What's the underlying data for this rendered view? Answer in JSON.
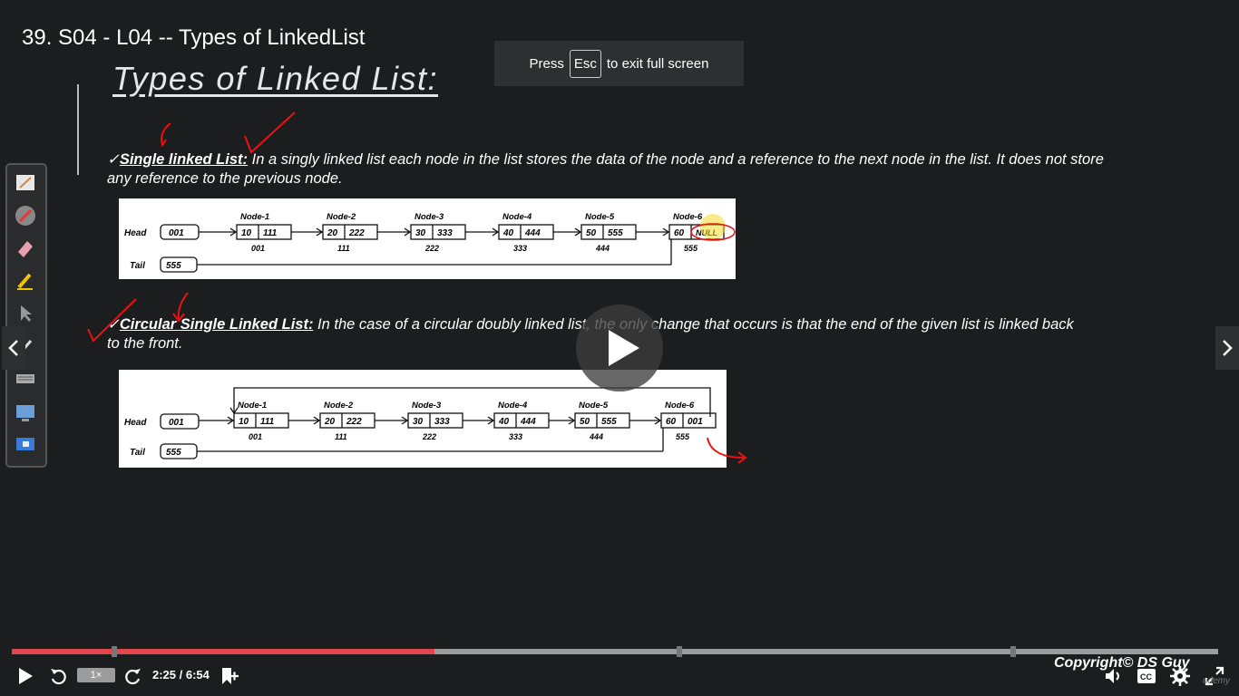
{
  "header": {
    "lecture_title": "39. S04 - L04 -- Types of LinkedList"
  },
  "fullscreen_notice": {
    "press": "Press",
    "key": "Esc",
    "suffix": "to exit full screen"
  },
  "slide": {
    "heading": "Types of Linked List:",
    "single": {
      "label": "Single linked List:",
      "text": "In a singly linked list each node in the list stores the data of the node and a reference to the next node in the list. It does not store any reference to the previous node."
    },
    "circular": {
      "label": "Circular Single Linked List:",
      "text": "In the case of a circular doubly linked list, the only change that occurs is that the end of the given list is linked back to the front."
    },
    "diagram_single": {
      "head_label": "Head",
      "head_value": "001",
      "tail_label": "Tail",
      "tail_value": "555",
      "nodes": [
        {
          "name": "Node-1",
          "data": "10",
          "next": "111",
          "addr": "001"
        },
        {
          "name": "Node-2",
          "data": "20",
          "next": "222",
          "addr": "111"
        },
        {
          "name": "Node-3",
          "data": "30",
          "next": "333",
          "addr": "222"
        },
        {
          "name": "Node-4",
          "data": "40",
          "next": "444",
          "addr": "333"
        },
        {
          "name": "Node-5",
          "data": "50",
          "next": "555",
          "addr": "444"
        },
        {
          "name": "Node-6",
          "data": "60",
          "next": "NULL",
          "addr": "555"
        }
      ]
    },
    "diagram_circular": {
      "head_label": "Head",
      "head_value": "001",
      "tail_label": "Tail",
      "tail_value": "555",
      "nodes": [
        {
          "name": "Node-1",
          "data": "10",
          "next": "111",
          "addr": "001"
        },
        {
          "name": "Node-2",
          "data": "20",
          "next": "222",
          "addr": "111"
        },
        {
          "name": "Node-3",
          "data": "30",
          "next": "333",
          "addr": "222"
        },
        {
          "name": "Node-4",
          "data": "40",
          "next": "444",
          "addr": "333"
        },
        {
          "name": "Node-5",
          "data": "50",
          "next": "555",
          "addr": "444"
        },
        {
          "name": "Node-6",
          "data": "60",
          "next": "001",
          "addr": "555"
        }
      ]
    }
  },
  "player": {
    "time": "2:25 / 6:54",
    "speed": "1×",
    "progress_fraction": 0.35,
    "chapter_fractions": [
      0.083,
      0.551,
      0.828
    ],
    "copyright": "Copyright© DS Guy",
    "watermark": "udemy",
    "icons": [
      "play-icon",
      "rewind-icon",
      "forward-icon",
      "add-note-icon",
      "volume-icon",
      "captions-icon",
      "settings-icon",
      "expand-icon"
    ]
  },
  "colors": {
    "accent_progress": "#e1454d",
    "background": "#1c1d1f",
    "annotation_red": "#e11"
  }
}
